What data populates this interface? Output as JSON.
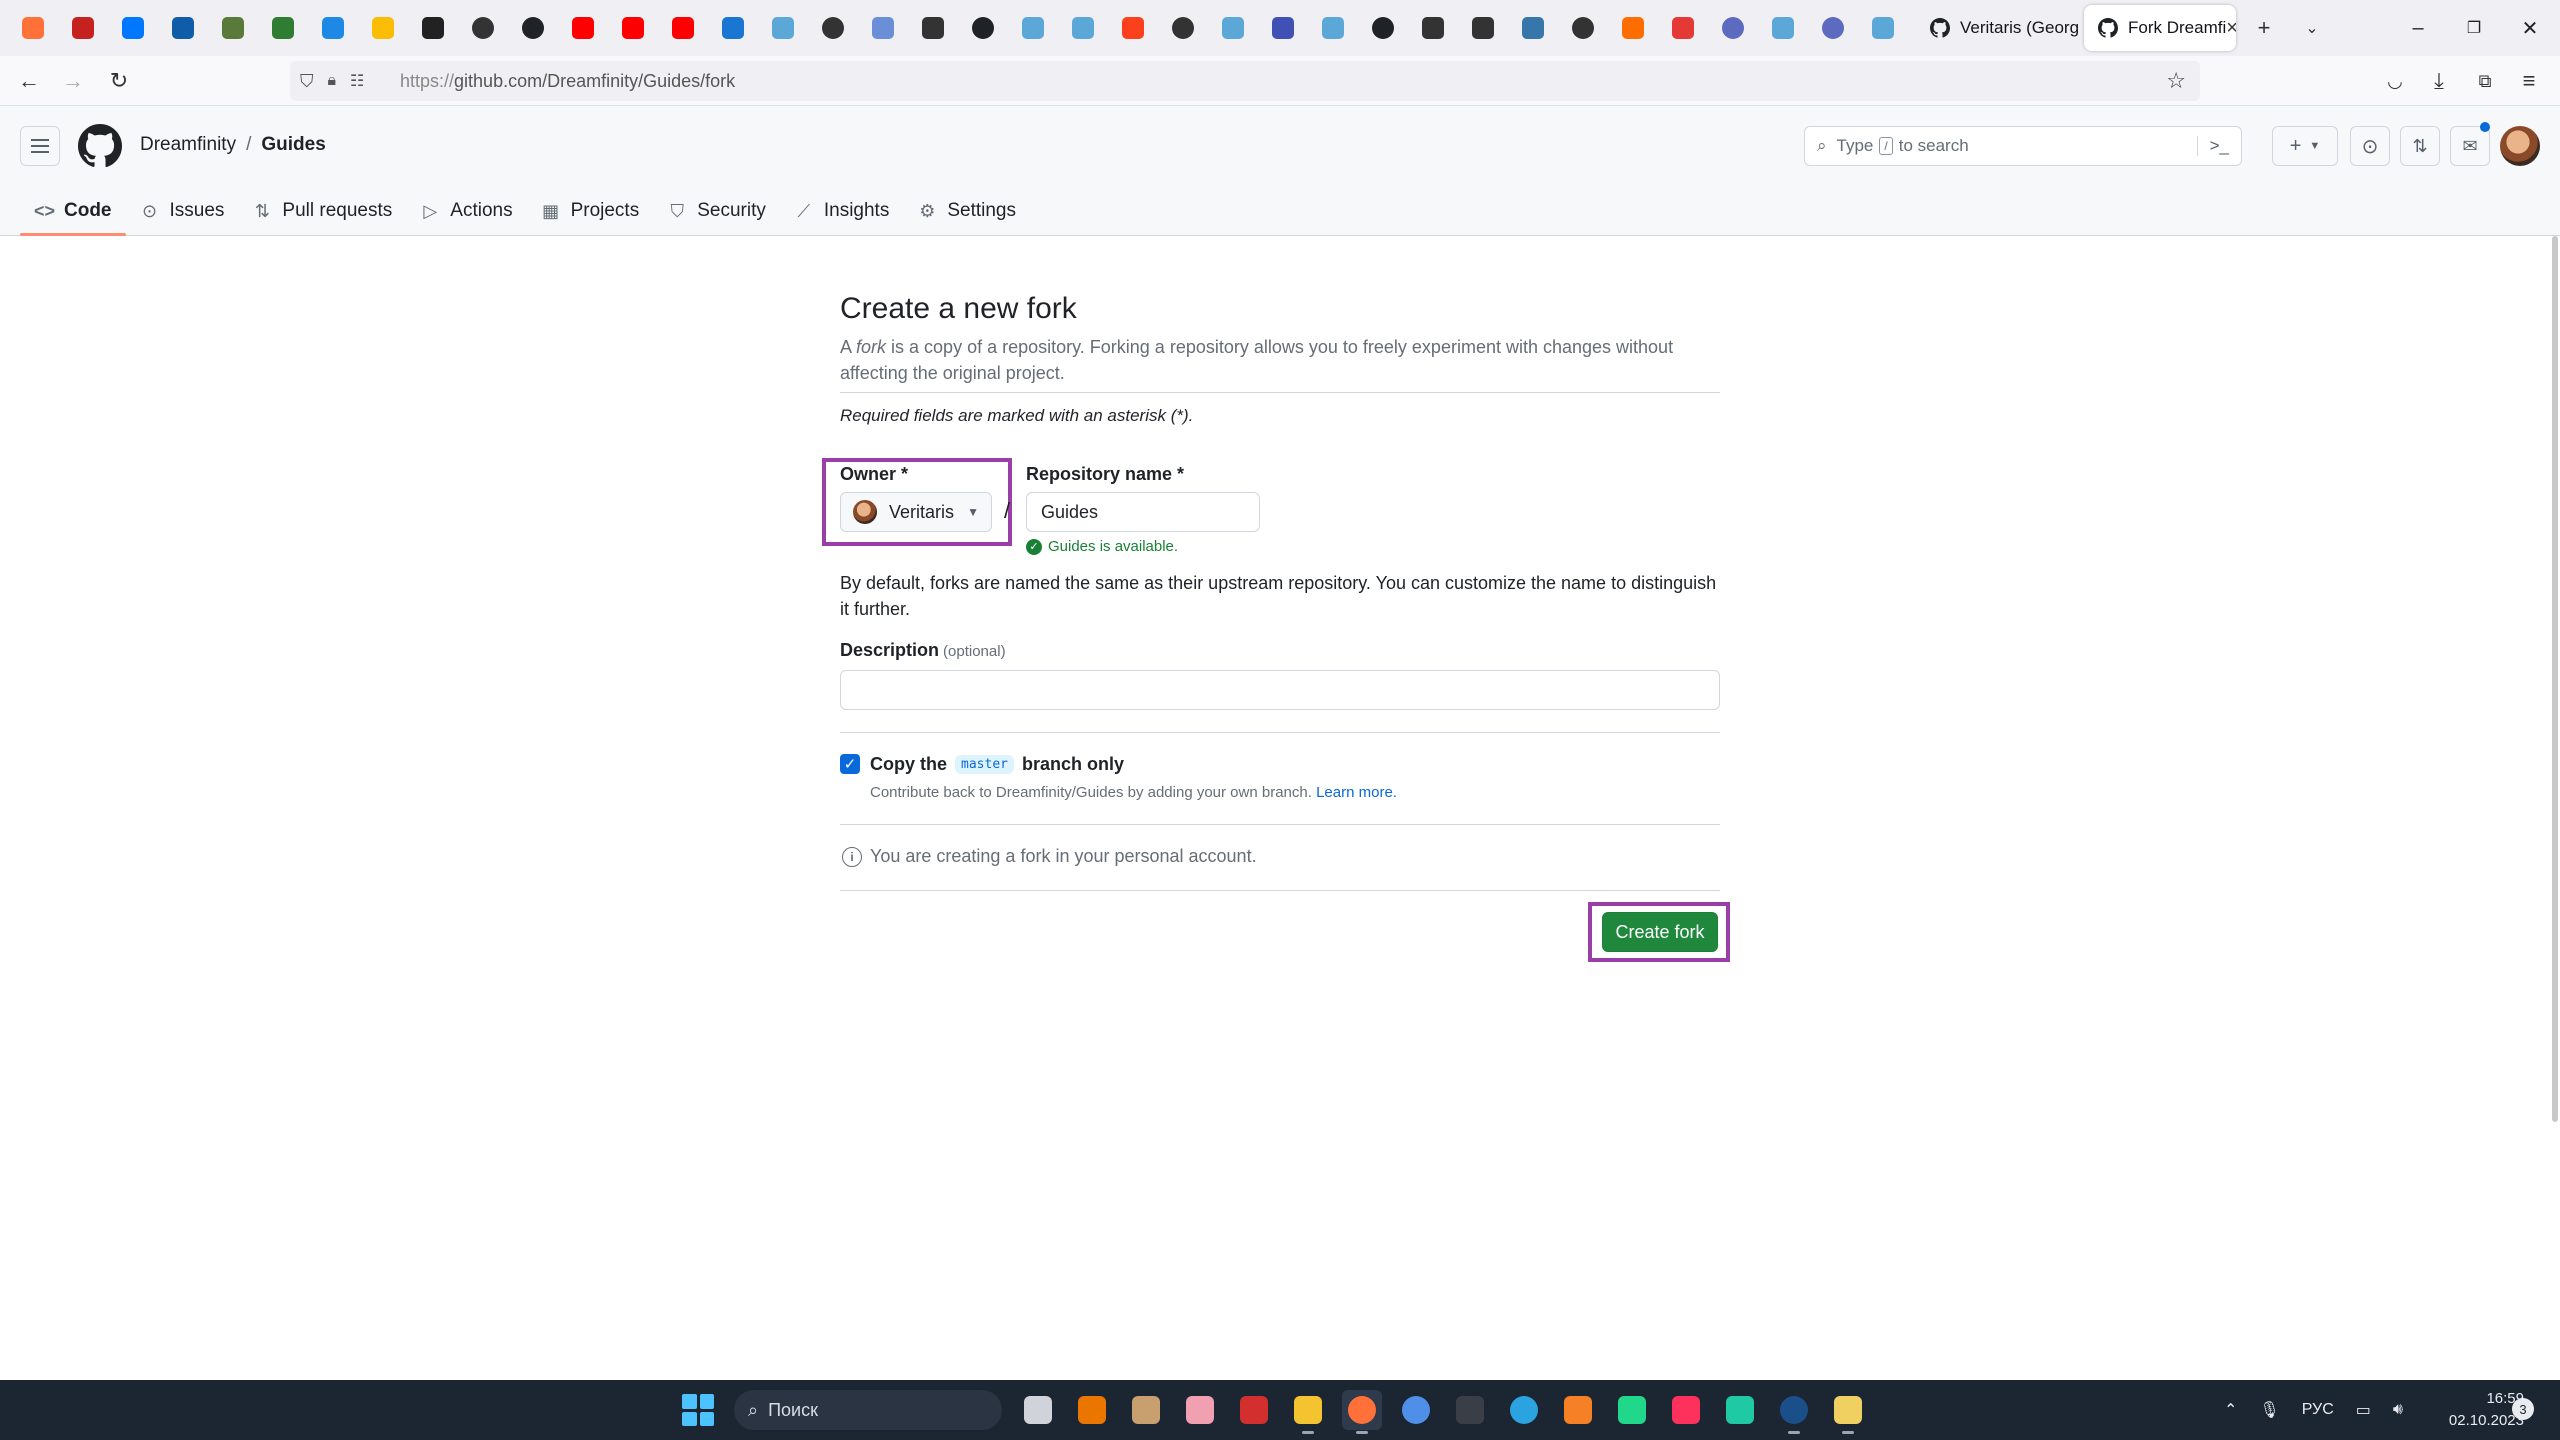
{
  "browser": {
    "pinned_tabs": [
      {
        "icon": "firefox-icon",
        "color": "#ff7139"
      },
      {
        "icon": "gmail-icon",
        "color": "#c5221f"
      },
      {
        "icon": "vk-icon",
        "color": "#0077ff"
      },
      {
        "icon": "pixiv-icon",
        "color": "#0f5ca8"
      },
      {
        "icon": "app-icon",
        "color": "#5a7a3a"
      },
      {
        "icon": "bridge-icon",
        "color": "#2e7d32"
      },
      {
        "icon": "bookmark-icon",
        "color": "#1e88e5"
      },
      {
        "icon": "google-drive-icon",
        "color": "#fbbc04"
      },
      {
        "icon": "app-icon",
        "color": "#222222"
      },
      {
        "icon": "globe-icon",
        "color": "#333333"
      },
      {
        "icon": "github-icon",
        "color": "#1f2328"
      },
      {
        "icon": "youtube-icon",
        "color": "#ff0000"
      },
      {
        "icon": "youtube-icon",
        "color": "#ff0000"
      },
      {
        "icon": "youtube-icon",
        "color": "#ff0000"
      },
      {
        "icon": "chat-icon",
        "color": "#1976d2"
      },
      {
        "icon": "app-icon",
        "color": "#5ba7d8"
      },
      {
        "icon": "globe-icon",
        "color": "#333333"
      },
      {
        "icon": "app-icon",
        "color": "#6a8fd8"
      },
      {
        "icon": "app-icon",
        "color": "#333333"
      },
      {
        "icon": "github-icon",
        "color": "#1f2328"
      },
      {
        "icon": "app-icon",
        "color": "#5ba7d8"
      },
      {
        "icon": "app-icon",
        "color": "#5ba7d8"
      },
      {
        "icon": "yandex-icon",
        "color": "#fc3f1d"
      },
      {
        "icon": "globe-icon",
        "color": "#333333"
      },
      {
        "icon": "app-icon",
        "color": "#5ba7d8"
      },
      {
        "icon": "app-icon",
        "color": "#3f51b5"
      },
      {
        "icon": "app-icon",
        "color": "#5ba7d8"
      },
      {
        "icon": "github-icon",
        "color": "#1f2328"
      },
      {
        "icon": "app-icon",
        "color": "#333333"
      },
      {
        "icon": "app-icon",
        "color": "#333333"
      },
      {
        "icon": "python-icon",
        "color": "#3776ab"
      },
      {
        "icon": "globe-icon",
        "color": "#333333"
      },
      {
        "icon": "app-icon",
        "color": "#ff6d00"
      },
      {
        "icon": "map-pin-icon",
        "color": "#e53935"
      },
      {
        "icon": "gear-icon",
        "color": "#5c6bc0"
      },
      {
        "icon": "app-icon",
        "color": "#5ba7d8"
      },
      {
        "icon": "gear-icon",
        "color": "#5c6bc0"
      },
      {
        "icon": "app-icon",
        "color": "#5ba7d8"
      }
    ],
    "tabs": [
      {
        "title": "Veritaris (Georg",
        "icon": "github-icon"
      },
      {
        "title": "Fork Dreamfi",
        "icon": "github-icon",
        "active": true
      }
    ],
    "url_prefix": "https://",
    "url": "github.com/Dreamfinity/Guides/fork"
  },
  "github": {
    "owner": "Dreamfinity",
    "separator": "/",
    "repo": "Guides",
    "search": {
      "prefix": "Type",
      "key": "/",
      "suffix": "to search"
    },
    "tabs": [
      {
        "label": "Code",
        "icon": "code-icon",
        "glyph": "<>"
      },
      {
        "label": "Issues",
        "icon": "issue-icon",
        "glyph": "⊙"
      },
      {
        "label": "Pull requests",
        "icon": "pull-request-icon",
        "glyph": "⇅"
      },
      {
        "label": "Actions",
        "icon": "actions-icon",
        "glyph": "▷"
      },
      {
        "label": "Projects",
        "icon": "projects-icon",
        "glyph": "▦"
      },
      {
        "label": "Security",
        "icon": "shield-icon",
        "glyph": "⛉"
      },
      {
        "label": "Insights",
        "icon": "graph-icon",
        "glyph": "⟋"
      },
      {
        "label": "Settings",
        "icon": "gear-icon",
        "glyph": "⚙"
      }
    ]
  },
  "form": {
    "title": "Create a new fork",
    "desc_pre": "A ",
    "desc_em": "fork",
    "desc_post": " is a copy of a repository. Forking a repository allows you to freely experiment with changes without affecting the original project.",
    "required_note": "Required fields are marked with an asterisk (*).",
    "owner_label": "Owner *",
    "owner_value": "Veritaris",
    "slash": "/",
    "repo_label": "Repository name *",
    "repo_value": "Guides",
    "availability": "Guides is available.",
    "default_note": "By default, forks are named the same as their upstream repository. You can customize the name to distinguish it further.",
    "description_label": "Description",
    "description_optional": "(optional)",
    "description_value": "",
    "copy_pre": "Copy the",
    "copy_branch": "master",
    "copy_post": "branch only",
    "copy_checked": true,
    "copy_help": "Contribute back to Dreamfinity/Guides by adding your own branch.",
    "learn_more": "Learn more.",
    "personal_note": "You are creating a fork in your personal account.",
    "create_button": "Create fork",
    "highlight_color": "#9b3fa8"
  },
  "taskbar": {
    "search_placeholder": "Поиск",
    "apps": [
      {
        "icon": "file-manager-icon",
        "color": "#d0d4da"
      },
      {
        "icon": "blender-icon",
        "color": "#ea7600"
      },
      {
        "icon": "app-icon",
        "color": "#c8a070"
      },
      {
        "icon": "app-icon",
        "color": "#f0a0b0"
      },
      {
        "icon": "app-icon",
        "color": "#d32f2f"
      },
      {
        "icon": "folder-icon",
        "color": "#f4c430"
      },
      {
        "icon": "firefox-icon",
        "color": "#ff7139",
        "active": true
      },
      {
        "icon": "firefox-icon",
        "color": "#4f8fe8"
      },
      {
        "icon": "terminal-icon",
        "color": "#3a3f47"
      },
      {
        "icon": "telegram-icon",
        "color": "#2aa3e0"
      },
      {
        "icon": "sublime-icon",
        "color": "#f58025"
      },
      {
        "icon": "pycharm-icon",
        "color": "#21d789"
      },
      {
        "icon": "intellij-icon",
        "color": "#fe315d"
      },
      {
        "icon": "clion-icon",
        "color": "#1fc9a3"
      },
      {
        "icon": "steam-icon",
        "color": "#1b4f8a"
      },
      {
        "icon": "app-icon",
        "color": "#f0d060"
      }
    ],
    "tray_lang": "РУС",
    "time": "16:59",
    "date": "02.10.2023",
    "notifications": "3"
  }
}
